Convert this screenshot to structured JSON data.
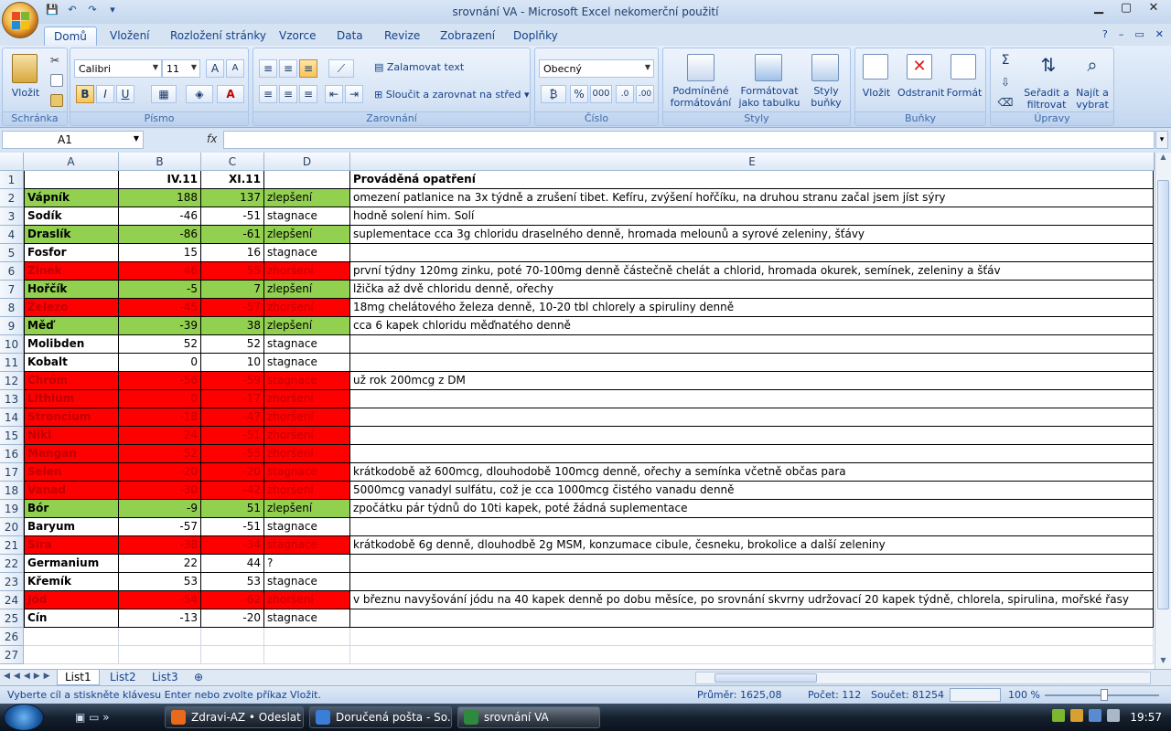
{
  "window": {
    "title": "srovnání VA - Microsoft Excel nekomerční použití",
    "controls": {
      "minimize": "▁",
      "maximize": "▢",
      "close": "✕"
    }
  },
  "ribbon_tabs": [
    "Domů",
    "Vložení",
    "Rozložení stránky",
    "Vzorce",
    "Data",
    "Revize",
    "Zobrazení",
    "Doplňky"
  ],
  "ribbon": {
    "clipboard": {
      "label": "Schránka",
      "paste": "Vložit"
    },
    "font": {
      "label": "Písmo",
      "font_name": "Calibri",
      "font_size": "11",
      "bold": "B",
      "italic": "I",
      "underline": "U"
    },
    "alignment": {
      "label": "Zarovnání",
      "wrap_text": "Zalamovat text",
      "merge_center": "Sloučit a zarovnat na střed"
    },
    "number": {
      "label": "Číslo",
      "format": "Obecný",
      "percent": "%",
      "thousands": "000"
    },
    "styles": {
      "label": "Styly",
      "conditional": "Podmíněné formátování",
      "as_table": "Formátovat jako tabulku",
      "cell_styles": "Styly buňky"
    },
    "cells": {
      "label": "Buňky",
      "insert": "Vložit",
      "delete": "Odstranit",
      "format": "Formát"
    },
    "editing": {
      "label": "Úpravy",
      "sum": "Σ",
      "sort_filter": "Seřadit a filtrovat",
      "find_select": "Najít a vybrat"
    }
  },
  "formula_bar": {
    "name_box": "A1",
    "fx": "fx",
    "value": ""
  },
  "columns": [
    "A",
    "B",
    "C",
    "D",
    "E"
  ],
  "rows": [
    {
      "n": "1",
      "a": "",
      "b": "IV.11",
      "c": "XI.11",
      "d": "",
      "e": "Prováděná opatření",
      "fill": "none",
      "header": true
    },
    {
      "n": "2",
      "a": "Vápník",
      "b": "188",
      "c": "137",
      "d": "zlepšení",
      "e": "omezení patlanice na 3x týdně a zrušení tibet. Kefíru, zvýšení hořčíku, na druhou stranu začal jsem jíst sýry",
      "fill": "green"
    },
    {
      "n": "3",
      "a": "Sodík",
      "b": "-46",
      "c": "-51",
      "d": "stagnace",
      "e": "hodně solení him. Solí",
      "fill": "none"
    },
    {
      "n": "4",
      "a": "Draslík",
      "b": "-86",
      "c": "-61",
      "d": "zlepšení",
      "e": "suplementace cca 3g chloridu draselného denně, hromada melounů a syrové zeleniny, šťávy",
      "fill": "green"
    },
    {
      "n": "5",
      "a": "Fosfor",
      "b": "15",
      "c": "16",
      "d": "stagnace",
      "e": "",
      "fill": "none"
    },
    {
      "n": "6",
      "a": "Zinek",
      "b": "46",
      "c": "55",
      "d": "zhoršení",
      "e": "první týdny 120mg zinku, poté 70-100mg denně částečně chelát a chlorid, hromada okurek, semínek, zeleniny a šťáv",
      "fill": "red"
    },
    {
      "n": "7",
      "a": "Hořčík",
      "b": "-5",
      "c": "7",
      "d": "zlepšení",
      "e": "lžička až dvě chloridu denně, ořechy",
      "fill": "green"
    },
    {
      "n": "8",
      "a": "Železo",
      "b": "-45",
      "c": "-57",
      "d": "zhoršení",
      "e": "18mg chelátového železa denně, 10-20 tbl chlorely a spiruliny denně",
      "fill": "red"
    },
    {
      "n": "9",
      "a": "Měď",
      "b": "-39",
      "c": "38",
      "d": "zlepšení",
      "e": "cca 6 kapek chloridu měďnatého denně",
      "fill": "green"
    },
    {
      "n": "10",
      "a": "Molibden",
      "b": "52",
      "c": "52",
      "d": "stagnace",
      "e": "",
      "fill": "none"
    },
    {
      "n": "11",
      "a": "Kobalt",
      "b": "0",
      "c": "10",
      "d": "stagnace",
      "e": "",
      "fill": "none"
    },
    {
      "n": "12",
      "a": "Chróm",
      "b": "-56",
      "c": "-59",
      "d": "stagnace",
      "e": "už rok 200mcg z DM",
      "fill": "red"
    },
    {
      "n": "13",
      "a": "Lithium",
      "b": "0",
      "c": "-17",
      "d": "zhoršení",
      "e": "",
      "fill": "red"
    },
    {
      "n": "14",
      "a": "Stroncium",
      "b": "-18",
      "c": "-47",
      "d": "zhoršení",
      "e": "",
      "fill": "red"
    },
    {
      "n": "15",
      "a": "Nikl",
      "b": "24",
      "c": "-51",
      "d": "zhoršení",
      "e": "",
      "fill": "red"
    },
    {
      "n": "16",
      "a": "Mangan",
      "b": "52",
      "c": "-55",
      "d": "zhoršení",
      "e": "",
      "fill": "red"
    },
    {
      "n": "17",
      "a": "Selen",
      "b": "-20",
      "c": "-20",
      "d": "stagnace",
      "e": "krátkodobě až 600mcg, dlouhodobě 100mcg denně, ořechy a semínka včetně občas para",
      "fill": "red"
    },
    {
      "n": "18",
      "a": "Vanad",
      "b": "-30",
      "c": "-42",
      "d": "zhoršení",
      "e": "5000mcg vanadyl sulfátu, což je cca 1000mcg čistého vanadu denně",
      "fill": "red"
    },
    {
      "n": "19",
      "a": "Bór",
      "b": "-9",
      "c": "51",
      "d": "zlepšení",
      "e": "zpočátku pár týdnů do 10ti kapek, poté žádná suplementace",
      "fill": "green"
    },
    {
      "n": "20",
      "a": "Baryum",
      "b": "-57",
      "c": "-51",
      "d": "stagnace",
      "e": "",
      "fill": "none"
    },
    {
      "n": "21",
      "a": "Síra",
      "b": "-38",
      "c": "-34",
      "d": "stagnace",
      "e": "krátkodobě 6g denně, dlouhodbě 2g MSM, konzumace cibule, česneku, brokolice a další zeleniny",
      "fill": "red"
    },
    {
      "n": "22",
      "a": "Germanium",
      "b": "22",
      "c": "44",
      "d": "?",
      "e": "",
      "fill": "none"
    },
    {
      "n": "23",
      "a": "Křemík",
      "b": "53",
      "c": "53",
      "d": "stagnace",
      "e": "",
      "fill": "none"
    },
    {
      "n": "24",
      "a": "Jód",
      "b": "-54",
      "c": "-62",
      "d": "zhoršení",
      "e": "v březnu navyšování jódu na 40 kapek denně po dobu měsíce, po srovnání skvrny udržovací 20 kapek týdně, chlorela, spirulina, mořské řasy",
      "fill": "red"
    },
    {
      "n": "25",
      "a": "Cín",
      "b": "-13",
      "c": "-20",
      "d": "stagnace",
      "e": "",
      "fill": "none"
    },
    {
      "n": "26",
      "a": "",
      "b": "",
      "c": "",
      "d": "",
      "e": "",
      "fill": "empty"
    },
    {
      "n": "27",
      "a": "",
      "b": "",
      "c": "",
      "d": "",
      "e": "",
      "fill": "empty"
    }
  ],
  "sheet_tabs": [
    "List1",
    "List2",
    "List3"
  ],
  "status": {
    "message": "Vyberte cíl a stiskněte klávesu Enter nebo zvolte příkaz Vložit.",
    "average": "Průměr: 1625,08",
    "count": "Počet: 112",
    "sum": "Součet: 81254",
    "zoom": "100 %"
  },
  "taskbar": {
    "buttons": [
      "Zdravi-AZ • Odeslat ...",
      "Doručená pošta - So...",
      "srovnání VA"
    ],
    "clock": "19:57"
  },
  "colors": {
    "green": "#92d050",
    "red": "#ff0000",
    "red_text": "#c00000"
  }
}
